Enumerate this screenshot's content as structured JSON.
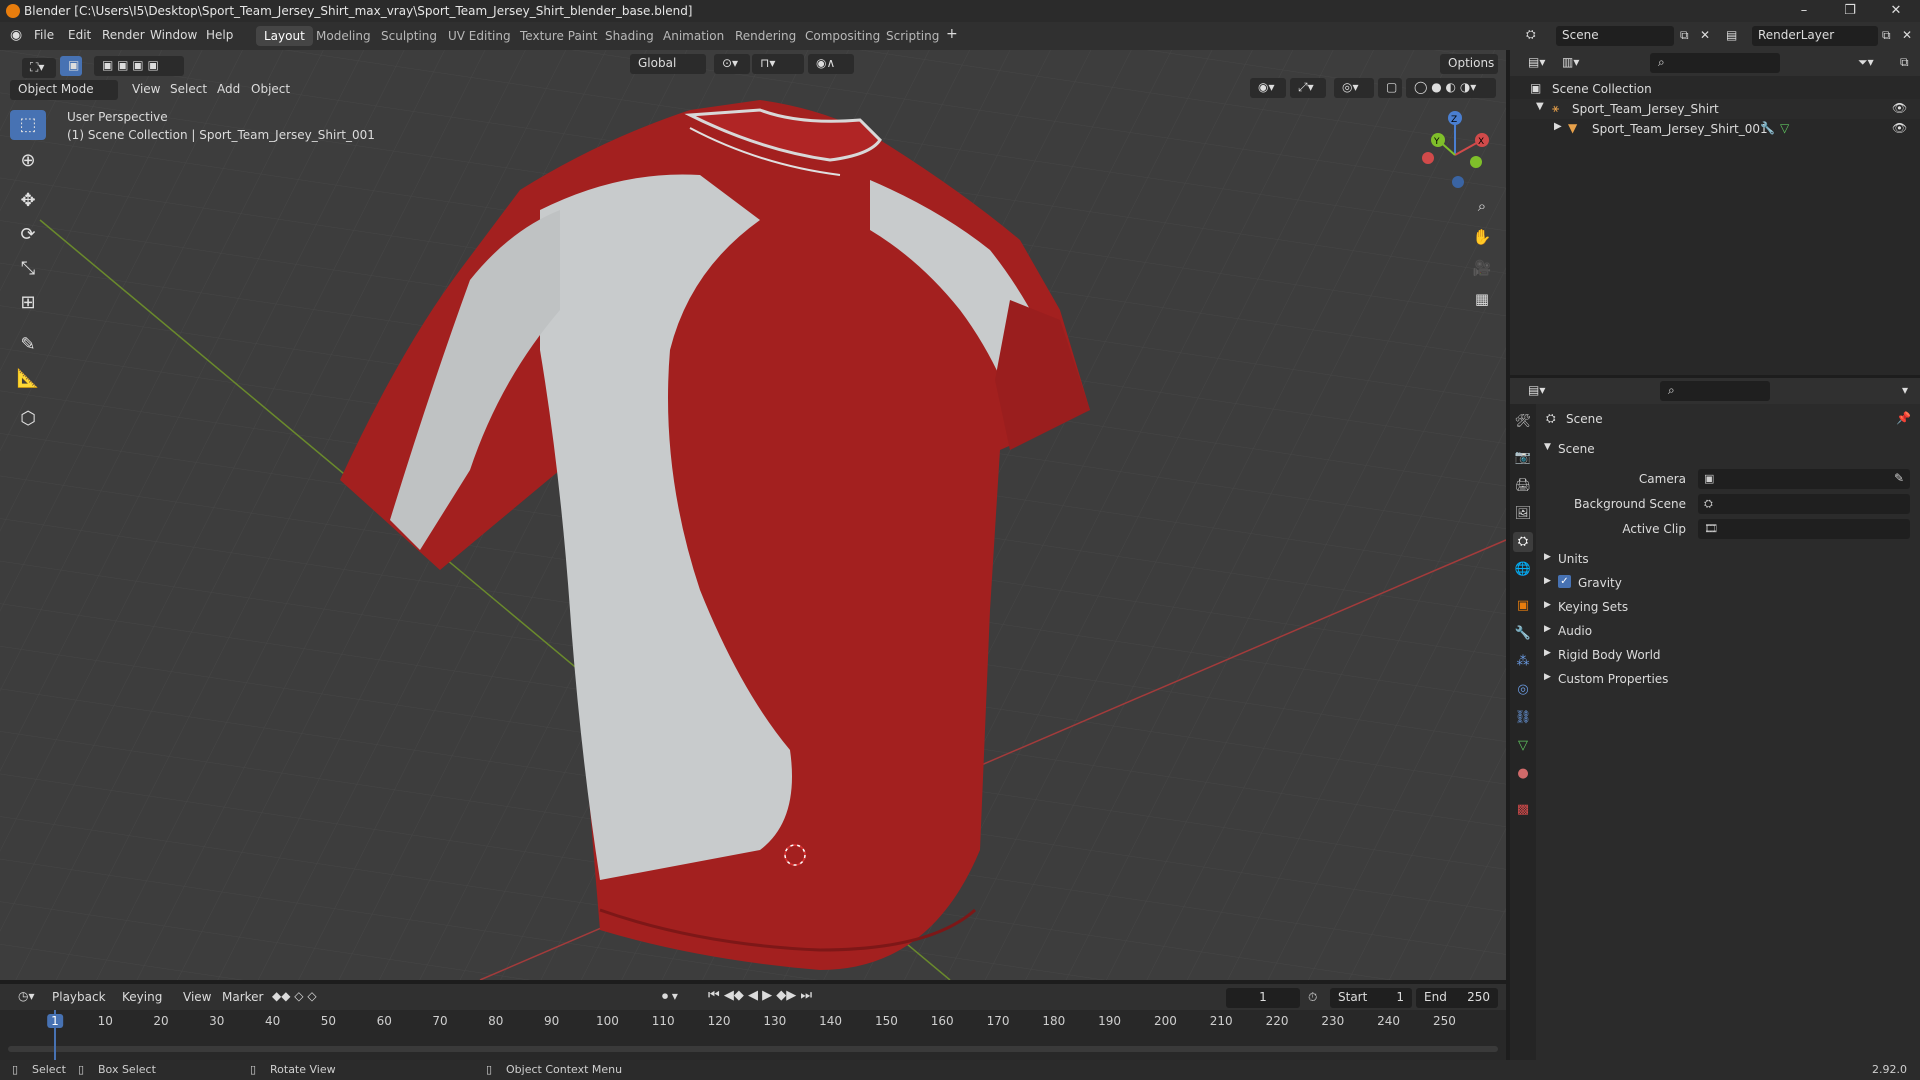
{
  "window": {
    "title": "Blender [C:\\Users\\I5\\Desktop\\Sport_Team_Jersey_Shirt_max_vray\\Sport_Team_Jersey_Shirt_blender_base.blend]",
    "minimize": "–",
    "maximize": "❐",
    "close": "✕"
  },
  "menu": {
    "items": [
      "File",
      "Edit",
      "Render",
      "Window",
      "Help"
    ]
  },
  "workspaces": {
    "tabs": [
      "Layout",
      "Modeling",
      "Sculpting",
      "UV Editing",
      "Texture Paint",
      "Shading",
      "Animation",
      "Rendering",
      "Compositing",
      "Scripting"
    ],
    "add": "+"
  },
  "scene_selector": {
    "value": "Scene"
  },
  "layer_selector": {
    "value": "RenderLayer"
  },
  "viewport": {
    "mode": "Object Mode",
    "menus": [
      "View",
      "Select",
      "Add",
      "Object"
    ],
    "transform": "Global",
    "options": "Options",
    "overlay_line1": "User Perspective",
    "overlay_line2": "(1) Scene Collection | Sport_Team_Jersey_Shirt_001",
    "gizmo": {
      "x": "X",
      "y": "Y",
      "z": "Z"
    }
  },
  "outliner": {
    "root": "Scene Collection",
    "items": [
      "Sport_Team_Jersey_Shirt",
      "Sport_Team_Jersey_Shirt_001"
    ]
  },
  "properties": {
    "context": "Scene",
    "panel_title": "Scene",
    "fields": {
      "camera": "Camera",
      "background_scene": "Background Scene",
      "active_clip": "Active Clip"
    },
    "panels": [
      "Units",
      "Gravity",
      "Keying Sets",
      "Audio",
      "Rigid Body World",
      "Custom Properties"
    ],
    "gravity_checked": true
  },
  "timeline": {
    "menus": [
      "Playback",
      "Keying",
      "View",
      "Marker"
    ],
    "current_frame": "1",
    "start_label": "Start",
    "start_value": "1",
    "end_label": "End",
    "end_value": "250",
    "ticks": [
      "1",
      "10",
      "20",
      "30",
      "40",
      "50",
      "60",
      "70",
      "80",
      "90",
      "100",
      "110",
      "120",
      "130",
      "140",
      "150",
      "160",
      "170",
      "180",
      "190",
      "200",
      "210",
      "220",
      "230",
      "240",
      "250"
    ]
  },
  "statusbar": {
    "select": "Select",
    "box_select": "Box Select",
    "rotate_view": "Rotate View",
    "context_menu": "Object Context Menu",
    "version": "2.92.0"
  },
  "colors": {
    "accent": "#4772b3",
    "jersey_red": "#a3201f",
    "jersey_white": "#c8cbcc"
  }
}
